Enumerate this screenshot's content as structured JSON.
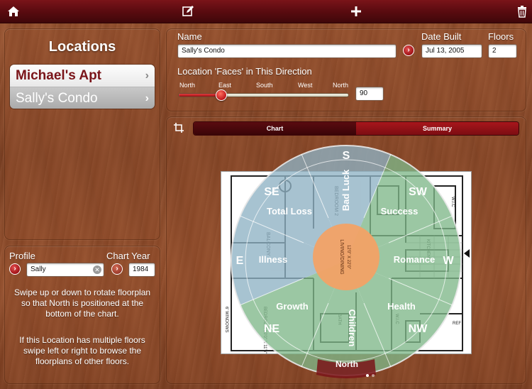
{
  "toolbar": {
    "home_icon": "home-icon",
    "edit_icon": "compose-icon",
    "add_icon": "plus-icon",
    "delete_icon": "trash-icon"
  },
  "locations": {
    "title": "Locations",
    "items": [
      {
        "label": "Michael's Apt"
      },
      {
        "label": "Sally's Condo"
      }
    ]
  },
  "profile": {
    "profile_label": "Profile",
    "profile_value": "Sally",
    "chart_year_label": "Chart Year",
    "chart_year_value": "1984",
    "help_rotate": "Swipe up or down to rotate floorplan so that North is positioned at the bottom of the chart.",
    "help_floors": "If this Location has multiple floors swipe left or right to browse the floorplans of other floors."
  },
  "details": {
    "name_label": "Name",
    "name_value": "Sally's Condo",
    "date_built_label": "Date Built",
    "date_built_value": "Jul 13, 2005",
    "floors_label": "Floors",
    "floors_value": "2",
    "faces_label": "Location 'Faces' in This Direction",
    "directions": [
      "North",
      "East",
      "South",
      "West",
      "North"
    ],
    "faces_value": "90",
    "faces_fraction": 0.25
  },
  "tabs": {
    "chart": "Chart",
    "summary": "Summary",
    "crop_icon": "crop-icon"
  },
  "chart_wheel": {
    "center": "LIVING/DINING",
    "center_dims": "12'0\" X 22'0\"",
    "south": "S",
    "southeast": "SE",
    "southwest": "SW",
    "east": "E",
    "west": "W",
    "northeast": "NE",
    "northwest": "NW",
    "north_label": "North",
    "zones": {
      "bad_luck": "Bad Luck",
      "total_loss": "Total Loss",
      "success": "Success",
      "illness": "Illness",
      "romance": "Romance",
      "growth": "Growth",
      "health": "Health",
      "children": "Children"
    },
    "room_labels": {
      "balcony": "BALCONY",
      "bedroom_top": "BEDROOM 2",
      "bedroom_left": "BEDROOM 10'0\" X 11'6\"",
      "windows": "6' WINDOWS",
      "kitchen": "KITCHEN",
      "wic_top": "W.I.C",
      "wic_bottom": "W.I.C",
      "bath": "BATH",
      "refrig": "REF"
    },
    "colors": {
      "blue_zone": "#8fb2c4",
      "green_zone": "#7fb88a",
      "center": "#f2a266",
      "outer_ring": "#8a8a8a"
    }
  }
}
